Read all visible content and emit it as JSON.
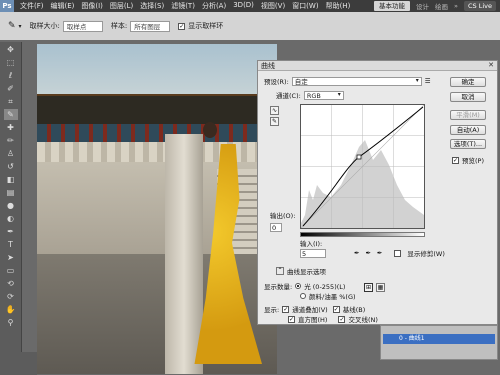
{
  "app": {
    "logo": "Ps",
    "zoom": "100%"
  },
  "menubar": {
    "items": [
      "文件(F)",
      "编辑(E)",
      "图像(I)",
      "图层(L)",
      "选择(S)",
      "滤镜(T)",
      "分析(A)",
      "3D(D)",
      "视图(V)",
      "窗口(W)",
      "帮助(H)"
    ],
    "workspace": "基本功能",
    "design": "设计",
    "paint": "绘画",
    "more": "»",
    "cslive": "CS Live"
  },
  "options": {
    "sample_size_label": "取样大小:",
    "sample_size_value": "取样点",
    "sample_label": "样本:",
    "sample_value": "所有图层",
    "show_ring_label": "显示取样环"
  },
  "curves": {
    "title": "曲线",
    "preset_label": "预设(R):",
    "preset_value": "自定",
    "channel_label": "通道(C):",
    "channel_value": "RGB",
    "ok": "确定",
    "cancel": "取消",
    "smooth": "平滑(M)",
    "auto": "自动(A)",
    "options": "选项(T)...",
    "preview": "预览(P)",
    "output_label": "输出(O):",
    "output_value": "0",
    "input_label": "输入(I):",
    "input_value": "5",
    "show_clipping": "显示修剪(W)",
    "display_options": "曲线显示选项",
    "show_amount_label": "显示数量:",
    "light_option": "光 (0-255)(L)",
    "pigment_option": "颜料/油墨 %(G)",
    "show_label": "显示:",
    "channel_overlay": "通道叠加(V)",
    "baseline": "基线(B)",
    "histogram": "直方图(H)",
    "intersection": "交叉线(N)"
  },
  "layers": {
    "row_label": "0 - 曲线1"
  }
}
